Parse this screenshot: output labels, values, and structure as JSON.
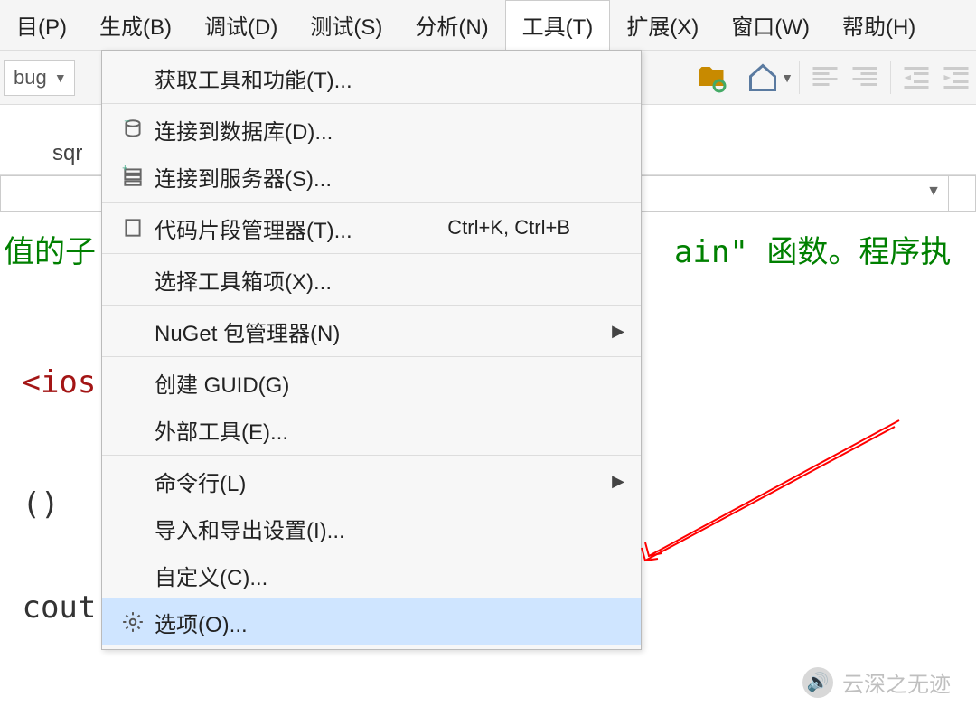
{
  "menubar": {
    "items": [
      "目(P)",
      "生成(B)",
      "调试(D)",
      "测试(S)",
      "分析(N)",
      "工具(T)",
      "扩展(X)",
      "窗口(W)",
      "帮助(H)"
    ]
  },
  "toolbar": {
    "config": "bug"
  },
  "filetab": {
    "text": "sqr"
  },
  "code": {
    "seg_left": "值的子",
    "seg_right": "ain\" 函数。程序执",
    "include": "<ios",
    "paren": "()",
    "cout": " cout"
  },
  "tools_menu": {
    "items": [
      {
        "icon": "",
        "label": "获取工具和功能(T)...",
        "shortcut": "",
        "arrow": false
      },
      {
        "sep": true
      },
      {
        "icon": "db-add",
        "label": "连接到数据库(D)...",
        "shortcut": "",
        "arrow": false
      },
      {
        "icon": "server-add",
        "label": "连接到服务器(S)...",
        "shortcut": "",
        "arrow": false
      },
      {
        "sep": true
      },
      {
        "icon": "snippet",
        "label": "代码片段管理器(T)...",
        "shortcut": "Ctrl+K, Ctrl+B",
        "arrow": false
      },
      {
        "sep": true
      },
      {
        "icon": "",
        "label": "选择工具箱项(X)...",
        "shortcut": "",
        "arrow": false
      },
      {
        "sep": true
      },
      {
        "icon": "",
        "label": "NuGet 包管理器(N)",
        "shortcut": "",
        "arrow": true
      },
      {
        "sep": true
      },
      {
        "icon": "",
        "label": "创建 GUID(G)",
        "shortcut": "",
        "arrow": false
      },
      {
        "icon": "",
        "label": "外部工具(E)...",
        "shortcut": "",
        "arrow": false
      },
      {
        "sep": true
      },
      {
        "icon": "",
        "label": "命令行(L)",
        "shortcut": "",
        "arrow": true
      },
      {
        "icon": "",
        "label": "导入和导出设置(I)...",
        "shortcut": "",
        "arrow": false
      },
      {
        "icon": "",
        "label": "自定义(C)...",
        "shortcut": "",
        "arrow": false
      },
      {
        "icon": "gear",
        "label": "选项(O)...",
        "shortcut": "",
        "arrow": false,
        "hl": true
      }
    ]
  },
  "watermark": {
    "icon": "🔊",
    "text": "云深之无迹"
  }
}
